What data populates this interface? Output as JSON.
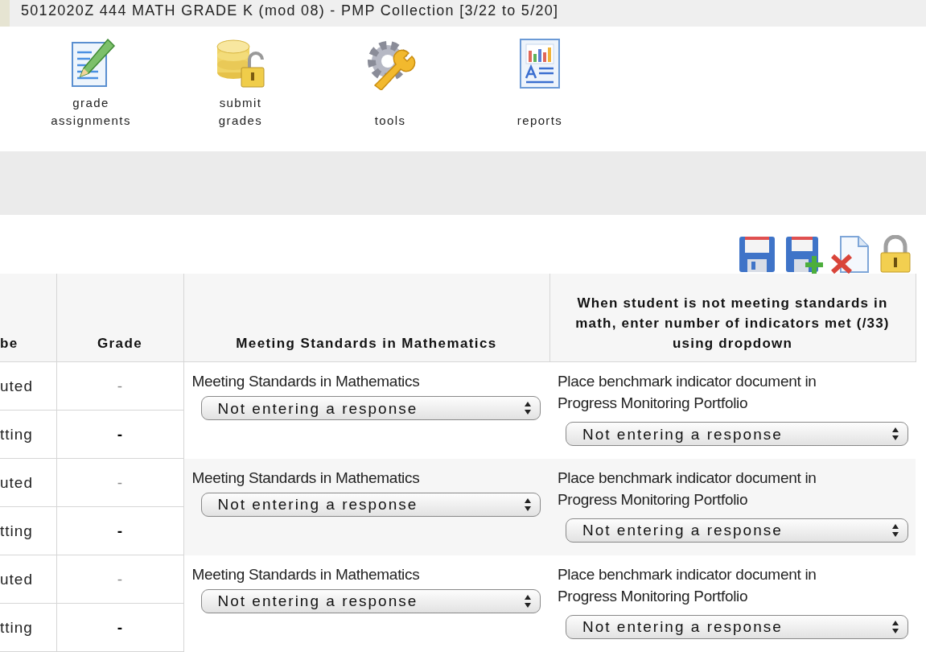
{
  "title": "5012020Z 444 MATH GRADE K (mod 08) - PMP Collection [3/22 to 5/20]",
  "toolbar": [
    {
      "label": "grade\nassignments"
    },
    {
      "label": "submit\ngrades"
    },
    {
      "label": "tools"
    },
    {
      "label": "reports"
    }
  ],
  "table": {
    "columns": [
      "be",
      "Grade",
      "Meeting Standards in Mathematics",
      "When student is not meeting standards in math, enter number of indicators met (/33) using dropdown"
    ],
    "rows": [
      {
        "column_1": [
          "uted",
          "tting"
        ],
        "grade": [
          "-",
          "-"
        ],
        "standard": {
          "label": "Meeting Standards in Mathematics",
          "value": "Not entering a response"
        },
        "indicators": {
          "label": "Place benchmark indicator document in Progress Monitoring Portfolio",
          "value": "Not entering a response"
        }
      },
      {
        "column_1": [
          "uted",
          "tting"
        ],
        "grade": [
          "-",
          "-"
        ],
        "standard": {
          "label": "Meeting Standards in Mathematics",
          "value": "Not entering a response"
        },
        "indicators": {
          "label": "Place benchmark indicator document in Progress Monitoring Portfolio",
          "value": "Not entering a response"
        }
      },
      {
        "column_1": [
          "uted",
          "tting"
        ],
        "grade": [
          "-",
          "-"
        ],
        "standard": {
          "label": "Meeting Standards in Mathematics",
          "value": "Not entering a response"
        },
        "indicators": {
          "label": "Place benchmark indicator document in Progress Monitoring Portfolio",
          "value": "Not entering a response"
        }
      }
    ]
  }
}
